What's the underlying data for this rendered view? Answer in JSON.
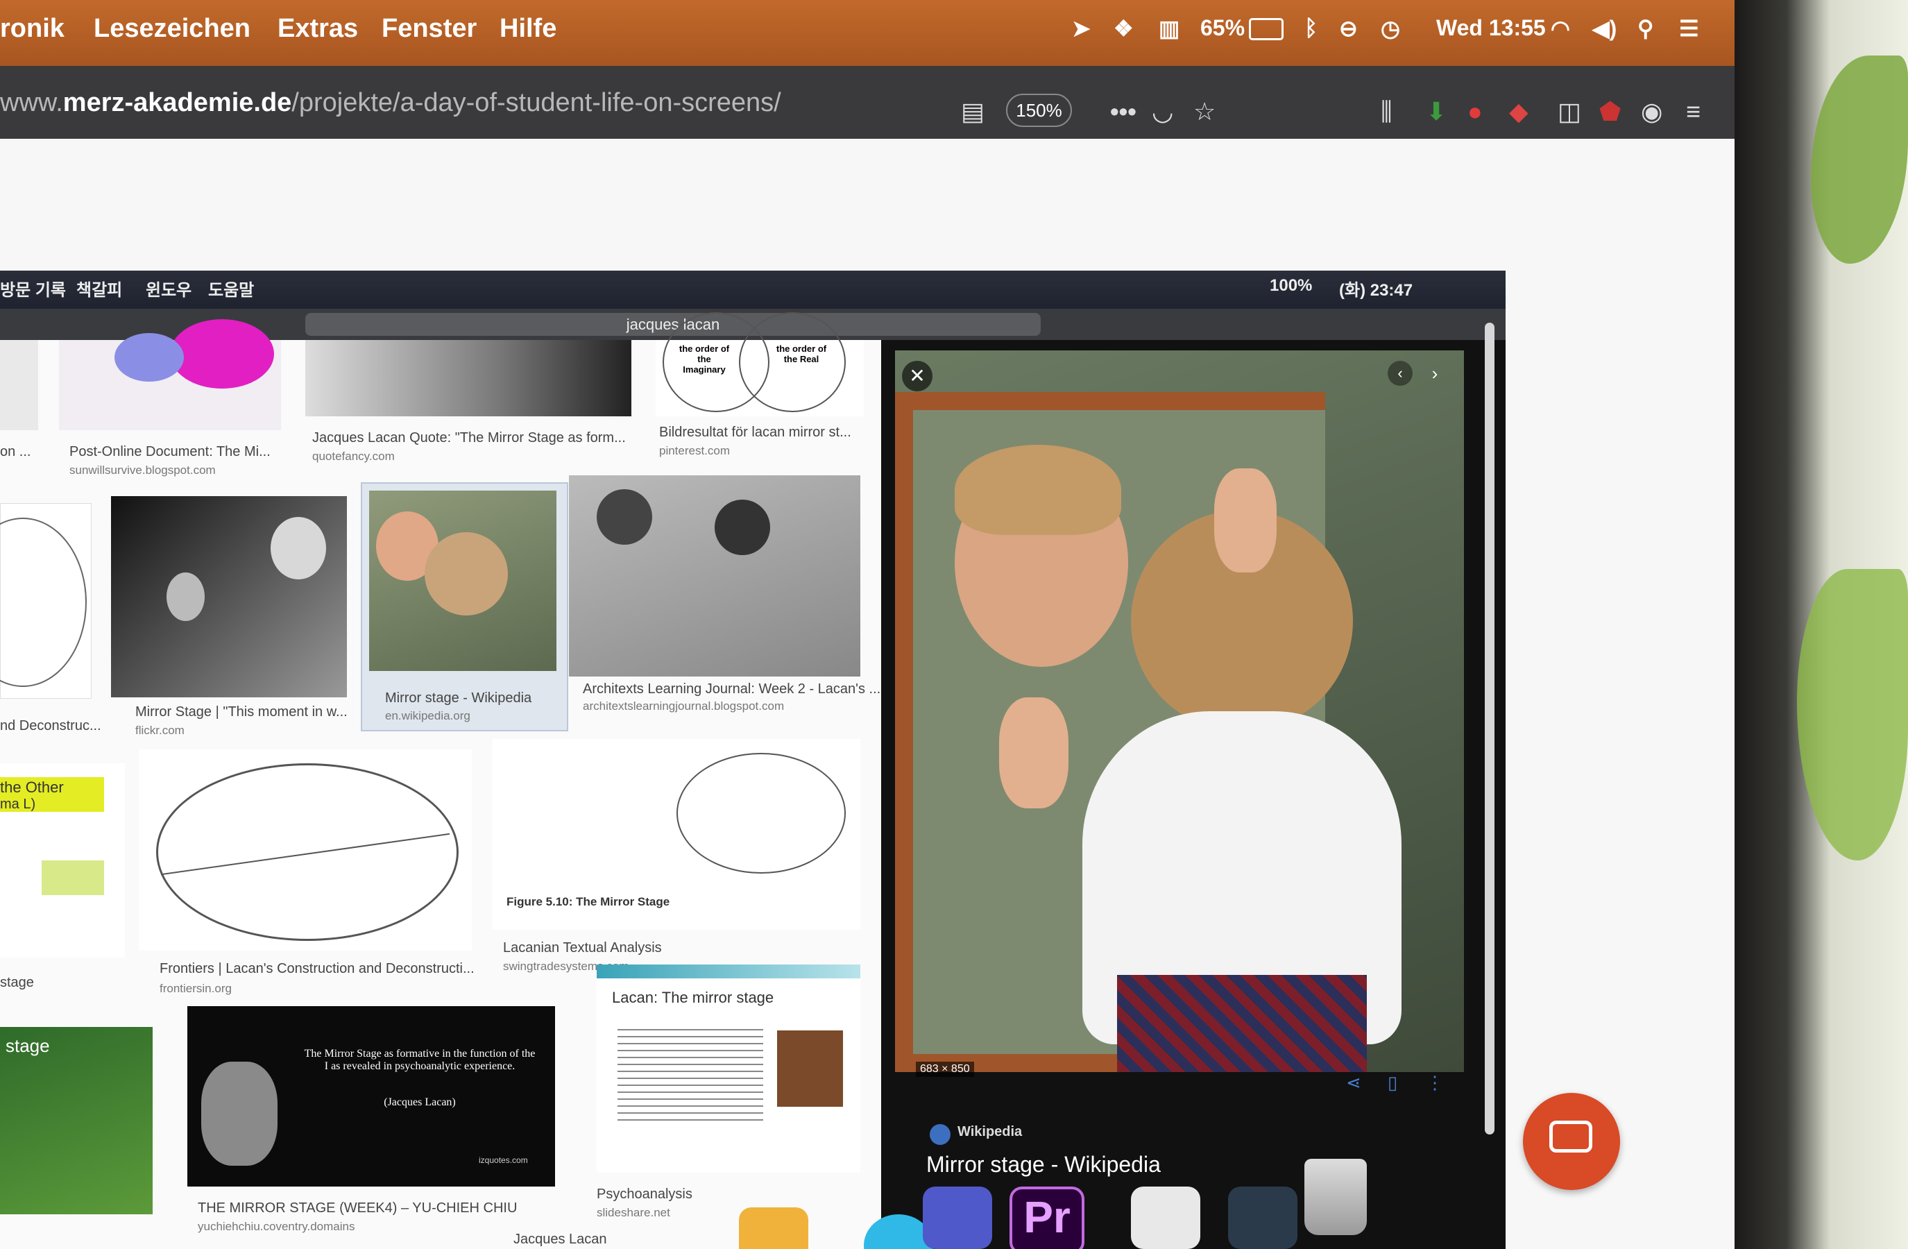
{
  "menubar": {
    "items": [
      "ronik",
      "Lesezeichen",
      "Extras",
      "Fenster",
      "Hilfe"
    ],
    "battery": "65%",
    "datetime": "Wed 13:55"
  },
  "browser": {
    "url_prefix": "www.",
    "url_domain": "merz-akademie.de",
    "url_path": "/projekte/a-day-of-student-life-on-screens/",
    "zoom": "150%",
    "more": "•••"
  },
  "inner": {
    "menu": [
      "방문 기록",
      "책갈피",
      "윈도우",
      "도움말"
    ],
    "status_battery": "100%",
    "status_time": "(화) 23:47",
    "search": "jacques lacan"
  },
  "results": [
    {
      "caption": "on ...",
      "source": ""
    },
    {
      "caption": "Post-Online Document: The Mi...",
      "source": "sunwillsurvive.blogspot.com"
    },
    {
      "caption": "Jacques Lacan Quote: \"The Mirror Stage as form...",
      "source": "quotefancy.com"
    },
    {
      "caption": "Bildresultat för lacan mirror st...",
      "source": "pinterest.com"
    },
    {
      "caption": "nd Deconstruc...",
      "source": ""
    },
    {
      "caption": "Mirror Stage | \"This moment in w...",
      "source": "flickr.com"
    },
    {
      "caption": "Mirror stage - Wikipedia",
      "source": "en.wikipedia.org"
    },
    {
      "caption": "Architexts Learning Journal: Week 2 - Lacan's ...",
      "source": "architextslearningjournal.blogspot.com"
    },
    {
      "caption": "stage",
      "source": ""
    },
    {
      "caption": "Frontiers | Lacan's Construction and Deconstructi...",
      "source": "frontiersin.org"
    },
    {
      "caption": "Lacanian Textual Analysis",
      "source": "swingtradesystems.com"
    },
    {
      "caption": "THE MIRROR STAGE (WEEK4) – YU-CHIEH CHIU",
      "source": "yuchiehchiu.coventry.domains"
    },
    {
      "caption": "Psychoanalysis",
      "source": "slideshare.net"
    }
  ],
  "thumb_text": {
    "venn_left": "the order of the Imaginary",
    "venn_right": "the order of the Real",
    "other_label": "the Other",
    "other_label2": "ma L)",
    "figure": "Figure 5.10: The Mirror Stage",
    "quote_title": "The Mirror Stage as formative in the function of the I as revealed in psychoanalytic experience.",
    "quote_author": "(Jacques Lacan)",
    "quote_site": "izquotes.com",
    "slide_title": "Lacan: The mirror stage",
    "green_title": "stage"
  },
  "viewer": {
    "dims": "683 × 850",
    "source": "Wikipedia",
    "title": "Mirror stage - Wikipedia"
  },
  "dock": {
    "premiere": "Pr"
  },
  "bottom_peek": "Jacques Lacan"
}
